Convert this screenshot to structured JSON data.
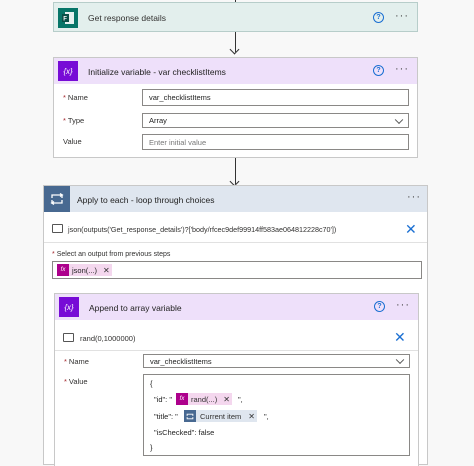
{
  "steps": {
    "get_response": {
      "title": "Get response details"
    },
    "init_variable": {
      "title": "Initialize variable - var checklistItems",
      "name_label": "Name",
      "name_value": "var_checklistItems",
      "type_label": "Type",
      "type_value": "Array",
      "value_label": "Value",
      "value_placeholder": "Enter initial value"
    },
    "apply_each": {
      "title": "Apply to each - loop through choices",
      "expression": "json(outputs('Get_response_details')?['body/rfcec9def99914ff583ae064812228c70'])",
      "select_label": "Select an output from previous steps",
      "token": "json(...)"
    },
    "append_array": {
      "title": "Append to array variable",
      "expression": "rand(0,1000000)",
      "name_label": "Name",
      "name_value": "var_checklistItems",
      "value_label": "Value",
      "lines": {
        "open": "{",
        "id_key": "\"id\": \"",
        "id_token": "rand(...)",
        "id_tail": "\",",
        "title_key": "\"title\": \"",
        "title_token": "Current item",
        "title_tail": "\",",
        "checked": "\"isChecked\": false",
        "close": "}"
      }
    }
  },
  "icons": {
    "forms": "forms-icon",
    "variable": "variable-icon",
    "loop": "loop-icon",
    "fx": "fx-icon",
    "help": "help-icon",
    "more": "more-icon",
    "close": "close-icon"
  },
  "colors": {
    "forms_green": "#077568",
    "variable_purple": "#770bd6",
    "variable_header": "#eee0fa",
    "loop_blue": "#486991",
    "loop_header": "#dfe6ef",
    "fx_magenta": "#ad008c"
  },
  "symbols": {
    "help": "?",
    "more": "···",
    "close": "✕",
    "token_close": "✕",
    "required": "*",
    "var": "{x}",
    "fx": "fx"
  }
}
